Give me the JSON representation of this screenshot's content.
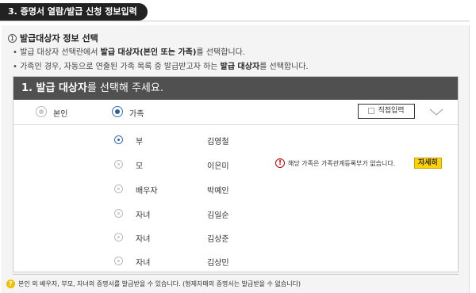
{
  "step_title": "3. 증명서 열람/발급 신청 정보입력",
  "section": {
    "number": "1",
    "title": "발급대상자 정보 선택"
  },
  "bullets": [
    {
      "pre": "• 발급 대상자 선택란에서 ",
      "bold": "발급 대상자(본인 또는 가족)",
      "post": "를 선택합니다."
    },
    {
      "pre": "• 가족인 경우, 자동으로 연출된 가족 목록 중 발급받고자 하는 ",
      "bold": "발급 대상자",
      "post": "를 선택합니다."
    }
  ],
  "panel": {
    "head_bold": "1. 발급 대상자",
    "head_rest": "를 선택해 주세요.",
    "options": [
      {
        "label": "본인",
        "selected": false
      },
      {
        "label": "가족",
        "selected": true
      }
    ],
    "direct_input_label": "직접입력"
  },
  "family": [
    {
      "relation": "부",
      "name": "김영철",
      "selected": true
    },
    {
      "relation": "모",
      "name": "이은미",
      "selected": false,
      "warning": "해당 가족은 가족관계등록부가 없습니다.",
      "detail_label": "자세히"
    },
    {
      "relation": "배우자",
      "name": "박예인",
      "selected": false
    },
    {
      "relation": "자녀",
      "name": "김일순",
      "selected": false
    },
    {
      "relation": "자녀",
      "name": "김상준",
      "selected": false
    },
    {
      "relation": "자녀",
      "name": "김상민",
      "selected": false
    }
  ],
  "note": "본인 외 배우자, 부모, 자녀의 증명서를 발급받을 수 있습니다. (형제자매의 증명서는 발급받을 수 없습니다)",
  "colors": {
    "accent": "#2b5fa8",
    "header_bg": "#505050",
    "detail_btn": "#ffd200",
    "warning": "#cc0000"
  }
}
